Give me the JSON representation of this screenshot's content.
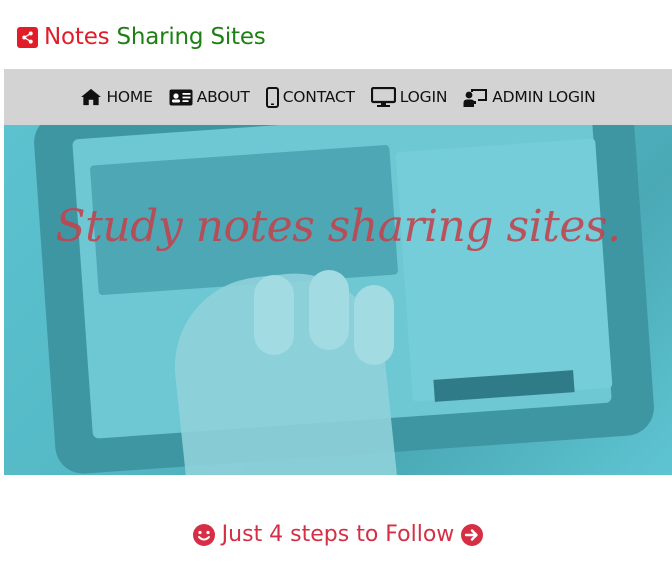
{
  "brand": {
    "word1": "Notes",
    "word2": "Sharing Sites",
    "icon": "share-icon"
  },
  "nav": {
    "items": [
      {
        "label": "HOME",
        "icon": "home-icon"
      },
      {
        "label": "ABOUT",
        "icon": "id-card-icon"
      },
      {
        "label": "CONTACT",
        "icon": "mobile-icon"
      },
      {
        "label": "LOGIN",
        "icon": "desktop-icon"
      },
      {
        "label": "ADMIN LOGIN",
        "icon": "chalkboard-teacher-icon"
      }
    ]
  },
  "hero": {
    "title": "Study notes sharing sites."
  },
  "steps": {
    "heading": "Just 4 steps to Follow",
    "left_icon": "smile-icon",
    "right_icon": "arrow-circle-right-icon"
  },
  "colors": {
    "brand_red": "#e11d2a",
    "brand_green": "#1e7f12",
    "nav_bg": "#d3d3d3",
    "hero_teal": "#5cc2cf",
    "steps_red": "#d62f45"
  }
}
